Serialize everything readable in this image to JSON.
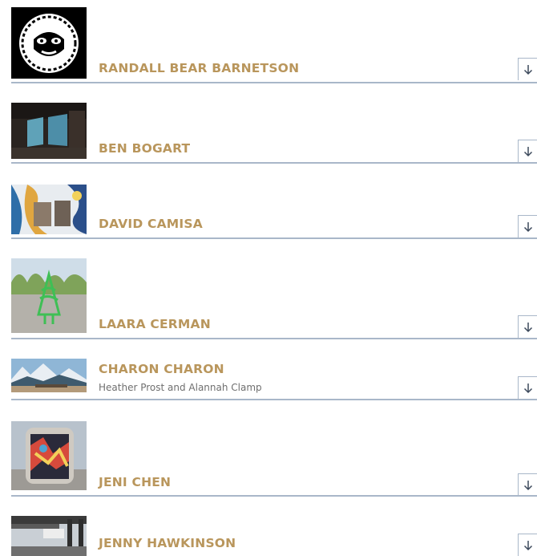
{
  "artists": [
    {
      "name": "RANDALL BEAR BARNETSON",
      "subtitle": "",
      "thumbnail_icon": "formline-mask-icon",
      "expand_icon": "arrow-down-icon"
    },
    {
      "name": "BEN BOGART",
      "subtitle": "",
      "thumbnail_icon": "gallery-screens-icon",
      "expand_icon": "arrow-down-icon"
    },
    {
      "name": "DAVID CAMISA",
      "subtitle": "",
      "thumbnail_icon": "mural-icon",
      "expand_icon": "arrow-down-icon"
    },
    {
      "name": "LAARA CERMAN",
      "subtitle": "",
      "thumbnail_icon": "tree-sculpture-icon",
      "expand_icon": "arrow-down-icon"
    },
    {
      "name": "CHARON CHARON",
      "subtitle": "Heather Prost and Alannah Clamp",
      "thumbnail_icon": "mountain-landscape-icon",
      "expand_icon": "arrow-down-icon"
    },
    {
      "name": "JENI CHEN",
      "subtitle": "",
      "thumbnail_icon": "wrapped-kiosk-icon",
      "expand_icon": "arrow-down-icon"
    },
    {
      "name": "JENNY HAWKINSON",
      "subtitle": "",
      "thumbnail_icon": "bridge-structure-icon",
      "expand_icon": "arrow-down-icon"
    }
  ],
  "colors": {
    "name_text": "#b9965c",
    "subtitle_text": "#6f6f6f",
    "divider": "#a9b7c9",
    "background": "#ffffff"
  }
}
